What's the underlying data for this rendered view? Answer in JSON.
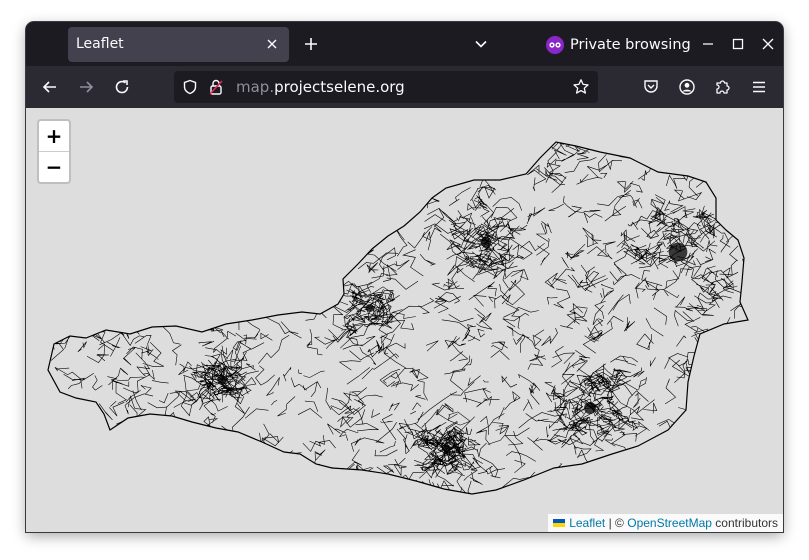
{
  "browser": {
    "tab_title": "Leaflet",
    "private_label": "Private browsing",
    "url_domain_prefix": "map.",
    "url_domain_main": "projectselene.org"
  },
  "map": {
    "zoom_in": "+",
    "zoom_out": "−",
    "attribution": {
      "leaflet": "Leaflet",
      "sep": "|",
      "copyright": "©",
      "osm": "OpenStreetMap",
      "contributors": "contributors"
    }
  },
  "colors": {
    "map_background": "#dddddd",
    "roads": "#000000",
    "accent_private": "#8a27c9",
    "link": "#0078a8"
  }
}
